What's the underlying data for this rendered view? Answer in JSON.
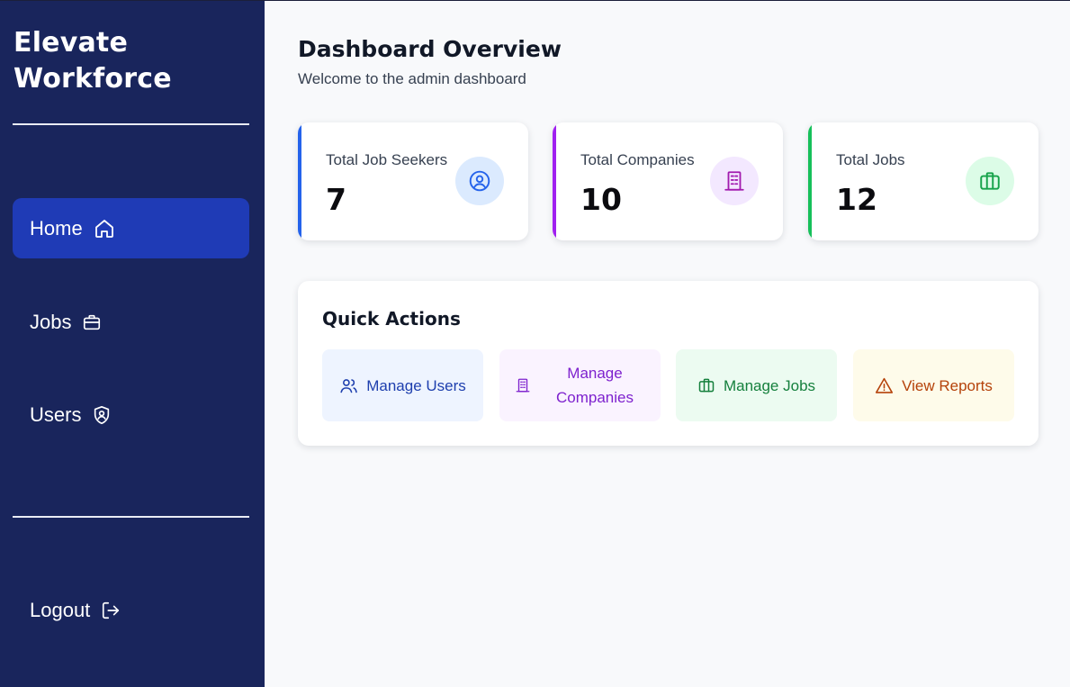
{
  "app": {
    "brand_line1": "Elevate",
    "brand_line2": "Workforce"
  },
  "sidebar": {
    "items": [
      {
        "label": "Home",
        "icon": "home-icon",
        "active": true
      },
      {
        "label": "Jobs",
        "icon": "briefcase-icon",
        "active": false
      },
      {
        "label": "Users",
        "icon": "user-shield-icon",
        "active": false
      }
    ],
    "logout": {
      "label": "Logout",
      "icon": "logout-icon"
    }
  },
  "header": {
    "title": "Dashboard Overview",
    "subtitle": "Welcome to the admin dashboard"
  },
  "stats": [
    {
      "label": "Total Job Seekers",
      "value": "7",
      "icon": "user-circle-icon",
      "accent": "#2563eb",
      "icon_bg": "#dbeafe",
      "icon_color": "#2563eb"
    },
    {
      "label": "Total Companies",
      "value": "10",
      "icon": "building-icon",
      "accent": "#a020f0",
      "icon_bg": "#f3e8ff",
      "icon_color": "#a21caf"
    },
    {
      "label": "Total Jobs",
      "value": "12",
      "icon": "briefcase-icon",
      "accent": "#16c05a",
      "icon_bg": "#dcfce7",
      "icon_color": "#16a34a"
    }
  ],
  "quick_actions": {
    "title": "Quick Actions",
    "buttons": [
      {
        "label": "Manage Users",
        "icon": "users-icon"
      },
      {
        "label": "Manage Companies",
        "icon": "building-icon"
      },
      {
        "label": "Manage Jobs",
        "icon": "briefcase-icon"
      },
      {
        "label": "View Reports",
        "icon": "warning-icon"
      }
    ]
  },
  "colors": {
    "sidebar_bg": "#19255c",
    "active_nav": "#1f3bb6",
    "page_bg": "#f8f9fb"
  }
}
